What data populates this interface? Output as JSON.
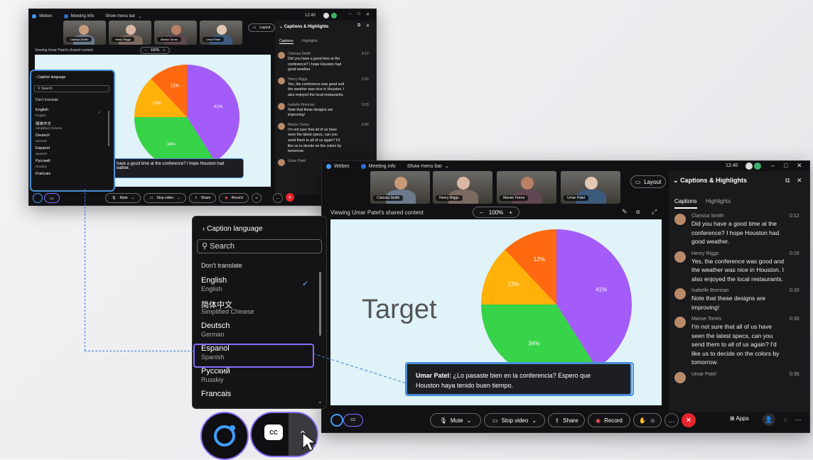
{
  "titlebar": {
    "app": "Webex",
    "meeting_info": "Meeting info",
    "show_menu_bar": "Show menu bar",
    "time": "12:40"
  },
  "participants": [
    {
      "name": "Clarissa Smith"
    },
    {
      "name": "Henry Riggs"
    },
    {
      "name": "Marise Torres"
    },
    {
      "name": "Umar Patel"
    }
  ],
  "layout_button": "Layout",
  "viewing_text": "Viewing Umar Patel's shared content",
  "zoom": "100%",
  "slide_title": "Target",
  "pie": {
    "slices": [
      {
        "label": "41%",
        "value": 41,
        "color": "#a35cf7"
      },
      {
        "label": "34%",
        "value": 34,
        "color": "#37d348"
      },
      {
        "label": "13%",
        "value": 13,
        "color": "#ffb10a"
      },
      {
        "label": "12%",
        "value": 12,
        "color": "#ff6a10"
      }
    ]
  },
  "caption_small": "have a good time at the conference? I hope Houston had … eather.",
  "caption_small_l1": "have a good time at the conference? I hope Houston had",
  "caption_small_l2": "eather.",
  "caption_large": {
    "speaker": "Umar Patel:",
    "text_l1": "¿Lo pasaste bien en la conferencia? Espero que",
    "text_l2": "Houston haya tenido buen tiempo."
  },
  "panel": {
    "title": "Captions & Highlights",
    "tab_captions": "Captions",
    "tab_highlights": "Highlights",
    "items": [
      {
        "name": "Clarissa Smith",
        "time": "0:12",
        "lines": [
          "Did you have a good time at the",
          "conference? I hope Houston had",
          "good weather."
        ]
      },
      {
        "name": "Henry Riggs",
        "time": "0:16",
        "lines": [
          "Yes, the conference was good and",
          "the weather was nice in Houston. I",
          "also enjoyed the local restaurants."
        ]
      },
      {
        "name": "Isabelle Brennan",
        "time": "0:20",
        "lines": [
          "Note that these designs are",
          "improving!"
        ]
      },
      {
        "name": "Marise Torres",
        "time": "0:30",
        "lines": [
          "I'm not sure that all of us have",
          "seen the latest specs, can you",
          "send them to all of us again? I'd",
          "like us to decide on the colors by",
          "tomorrow."
        ]
      },
      {
        "name": "Umar Patel",
        "time": "0:35",
        "lines": []
      }
    ]
  },
  "small_panel_items": [
    {
      "name": "Clarissa Smith",
      "time": "0:12",
      "lines": [
        "Did you have a good time at the",
        "conference? I hope Houston had",
        "good weather."
      ]
    },
    {
      "name": "Henry Riggs",
      "time": "0:16",
      "lines": [
        "Yes, the conference was good and",
        "the weather was nice in Houston. I",
        "also enjoyed the local restaurants."
      ]
    },
    {
      "name": "Isabelle Brennan",
      "time": "0:20",
      "lines": [
        "Note that these designs are",
        "improving!"
      ]
    },
    {
      "name": "Marise Torres",
      "time": "0:30",
      "lines": [
        "I'm not sure that all of us have",
        "seen the latest specs, can you",
        "send them to all of us again? I'd",
        "like us to decide on the colors by",
        "tomorrow."
      ]
    },
    {
      "name": "Umar Patel",
      "time": "",
      "lines": []
    }
  ],
  "language_menu": {
    "back_label": "Caption language",
    "search_placeholder": "Search",
    "dont_translate": "Don't translate",
    "languages": [
      {
        "name": "English",
        "sub": "English",
        "checked": true
      },
      {
        "name": "简体中文",
        "sub": "Simplified Chinese",
        "checked": false
      },
      {
        "name": "Deutsch",
        "sub": "German",
        "checked": false
      },
      {
        "name": "Espanol",
        "sub": "Spanish",
        "checked": false,
        "selected": true
      },
      {
        "name": "Русский",
        "sub": "Russkiy",
        "checked": false
      },
      {
        "name": "Francais",
        "sub": "",
        "checked": false
      }
    ]
  },
  "controls": {
    "mute": "Mute",
    "stop_video": "Stop video",
    "share": "Share",
    "record": "Record",
    "apps": "Apps"
  },
  "cc_label": "CC",
  "colors": {
    "accent_blue": "#4a8fd8",
    "highlight_purple": "#8a6bff",
    "end_red": "#e8242d",
    "record_red": "#ff5a5a"
  }
}
